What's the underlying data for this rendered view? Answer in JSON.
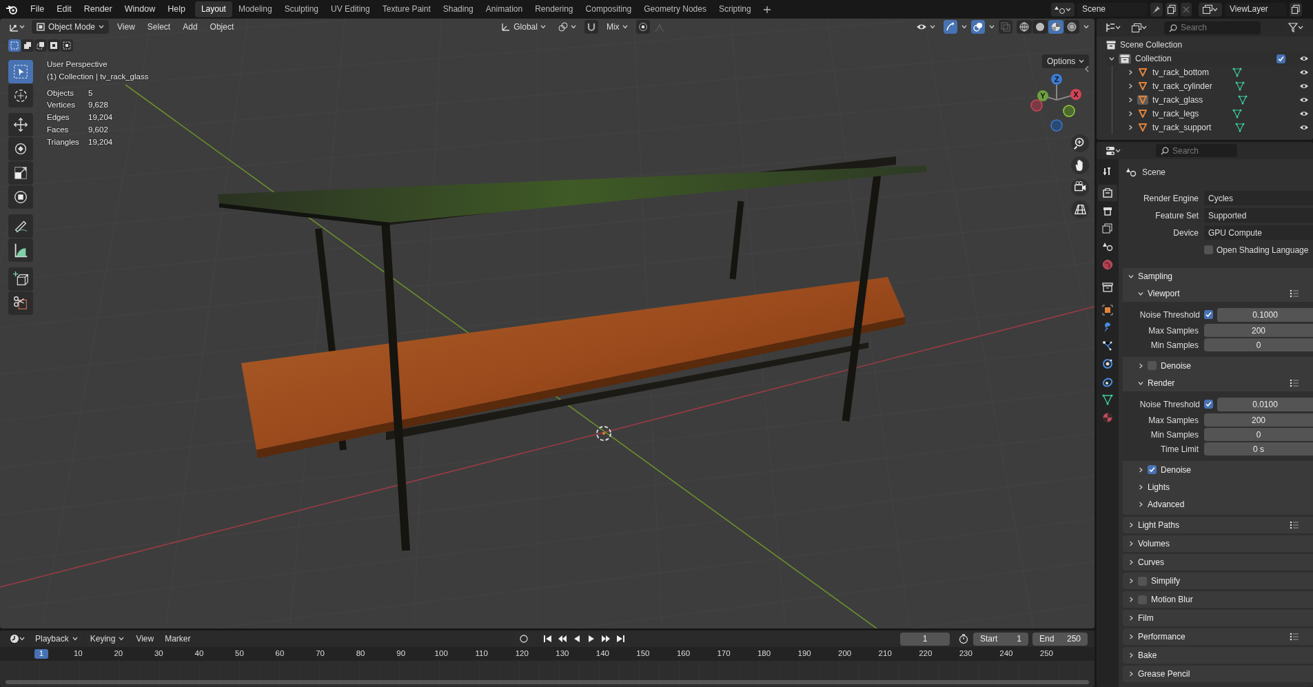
{
  "top_menu": [
    "File",
    "Edit",
    "Render",
    "Window",
    "Help"
  ],
  "workspaces": [
    {
      "label": "Layout",
      "selected": true
    },
    {
      "label": "Modeling",
      "selected": false
    },
    {
      "label": "Sculpting",
      "selected": false
    },
    {
      "label": "UV Editing",
      "selected": false
    },
    {
      "label": "Texture Paint",
      "selected": false
    },
    {
      "label": "Shading",
      "selected": false
    },
    {
      "label": "Animation",
      "selected": false
    },
    {
      "label": "Rendering",
      "selected": false
    },
    {
      "label": "Compositing",
      "selected": false
    },
    {
      "label": "Geometry Nodes",
      "selected": false
    },
    {
      "label": "Scripting",
      "selected": false
    }
  ],
  "scene": "Scene",
  "view_layer": "ViewLayer",
  "viewport_header": {
    "mode": "Object Mode",
    "menus": [
      "View",
      "Select",
      "Add",
      "Object"
    ],
    "orientation": "Global",
    "snapping": "Mix",
    "options": "Options",
    "shading": [
      {
        "kind": "wireframe",
        "selected": false
      },
      {
        "kind": "solid",
        "selected": false
      },
      {
        "kind": "material",
        "selected": true
      },
      {
        "kind": "rendered",
        "selected": false
      }
    ]
  },
  "select_modes": [
    {
      "kind": "set",
      "selected": true
    },
    {
      "kind": "extend",
      "selected": false
    },
    {
      "kind": "subtract",
      "selected": false
    },
    {
      "kind": "invert",
      "selected": false
    },
    {
      "kind": "intersect",
      "selected": false
    }
  ],
  "tools": [
    {
      "kind": "select",
      "selected": true
    },
    {
      "kind": "cursor",
      "selected": false
    },
    {
      "kind": "move",
      "selected": false
    },
    {
      "kind": "rotate",
      "selected": false
    },
    {
      "kind": "scale",
      "selected": false
    },
    {
      "kind": "transform",
      "selected": false
    },
    {
      "kind": "annotate",
      "selected": false
    },
    {
      "kind": "measure",
      "selected": false
    },
    {
      "kind": "add-cube",
      "selected": false
    },
    {
      "kind": "cut",
      "selected": false
    }
  ],
  "viewport_info": {
    "view": "User Perspective",
    "context": "(1) Collection | tv_rack_glass",
    "stats": [
      {
        "label": "Objects",
        "value": "5"
      },
      {
        "label": "Vertices",
        "value": "9,628"
      },
      {
        "label": "Edges",
        "value": "19,204"
      },
      {
        "label": "Faces",
        "value": "9,602"
      },
      {
        "label": "Triangles",
        "value": "19,204"
      }
    ]
  },
  "gizmo": {
    "z": "Z",
    "y": "Y",
    "x": "X"
  },
  "outliner": {
    "search_placeholder": "Search",
    "root": "Scene Collection",
    "collection": {
      "label": "Collection",
      "expanded": true,
      "checked": true,
      "children": [
        {
          "label": "tv_rack_bottom",
          "selected": false
        },
        {
          "label": "tv_rack_cylinder",
          "selected": false
        },
        {
          "label": "tv_rack_glass",
          "selected": true
        },
        {
          "label": "tv_rack_legs",
          "selected": false
        },
        {
          "label": "tv_rack_support",
          "selected": false
        }
      ]
    }
  },
  "properties": {
    "search_placeholder": "Search",
    "tabs": [
      {
        "kind": "tool",
        "selected": false
      },
      {
        "kind": "render",
        "selected": true
      },
      {
        "kind": "output",
        "selected": false
      },
      {
        "kind": "view-layer",
        "selected": false
      },
      {
        "kind": "scene",
        "selected": false
      },
      {
        "kind": "world",
        "selected": false
      },
      {
        "kind": "collection",
        "selected": false
      },
      {
        "kind": "object",
        "selected": false
      },
      {
        "kind": "modifier",
        "selected": false
      },
      {
        "kind": "particles",
        "selected": false
      },
      {
        "kind": "physics",
        "selected": false
      },
      {
        "kind": "constraints",
        "selected": false
      },
      {
        "kind": "data",
        "selected": false
      },
      {
        "kind": "material",
        "selected": false
      }
    ],
    "context": "Scene",
    "fields": [
      {
        "label": "Render Engine",
        "value": "Cycles"
      },
      {
        "label": "Feature Set",
        "value": "Supported"
      },
      {
        "label": "Device",
        "value": "GPU Compute"
      }
    ],
    "osl": {
      "label": "Open Shading Language",
      "checked": false
    },
    "panels": [
      {
        "kind": "plain",
        "label": "Sampling",
        "expanded": true,
        "presets": false,
        "children": [
          {
            "kind": "subpanel",
            "label": "Viewport",
            "expanded": true,
            "presets": true,
            "rows": [
              {
                "kind": "check-number",
                "label": "Noise Threshold",
                "checked": true,
                "value": "0.1000"
              },
              {
                "kind": "number",
                "label": "Max Samples",
                "value": "200"
              },
              {
                "kind": "number",
                "label": "Min Samples",
                "value": "0"
              }
            ]
          },
          {
            "kind": "check",
            "label": "Denoise",
            "checked": false
          },
          {
            "kind": "subpanel",
            "label": "Render",
            "expanded": true,
            "presets": true,
            "rows": [
              {
                "kind": "check-number",
                "label": "Noise Threshold",
                "checked": true,
                "value": "0.0100"
              },
              {
                "kind": "number",
                "label": "Max Samples",
                "value": "200"
              },
              {
                "kind": "number",
                "label": "Min Samples",
                "value": "0"
              },
              {
                "kind": "number",
                "label": "Time Limit",
                "value": "0 s"
              }
            ]
          },
          {
            "kind": "check",
            "label": "Denoise",
            "checked": true
          },
          {
            "kind": "plain",
            "label": "Lights"
          },
          {
            "kind": "plain",
            "label": "Advanced"
          }
        ]
      },
      {
        "kind": "plain",
        "label": "Light Paths",
        "expanded": false,
        "presets": true
      },
      {
        "kind": "plain",
        "label": "Volumes",
        "expanded": false,
        "presets": false
      },
      {
        "kind": "plain",
        "label": "Curves",
        "expanded": false,
        "presets": false
      },
      {
        "kind": "check",
        "label": "Simplify",
        "checked": false,
        "expanded": false,
        "presets": false
      },
      {
        "kind": "check",
        "label": "Motion Blur",
        "checked": false,
        "expanded": false,
        "presets": false
      },
      {
        "kind": "plain",
        "label": "Film",
        "expanded": false,
        "presets": false
      },
      {
        "kind": "plain",
        "label": "Performance",
        "expanded": false,
        "presets": true
      },
      {
        "kind": "plain",
        "label": "Bake",
        "expanded": false,
        "presets": false
      },
      {
        "kind": "plain",
        "label": "Grease Pencil",
        "expanded": false,
        "presets": false
      }
    ]
  },
  "timeline": {
    "menus": [
      "Playback",
      "Keying",
      "View",
      "Marker"
    ],
    "current_frame": "1",
    "start_label": "Start",
    "start": "1",
    "end_label": "End",
    "end": "250",
    "playhead": "1",
    "ticks": [
      "10",
      "20",
      "30",
      "40",
      "50",
      "60",
      "70",
      "80",
      "90",
      "100",
      "110",
      "120",
      "130",
      "140",
      "150",
      "160",
      "170",
      "180",
      "190",
      "200",
      "210",
      "220",
      "230",
      "240",
      "250"
    ]
  }
}
